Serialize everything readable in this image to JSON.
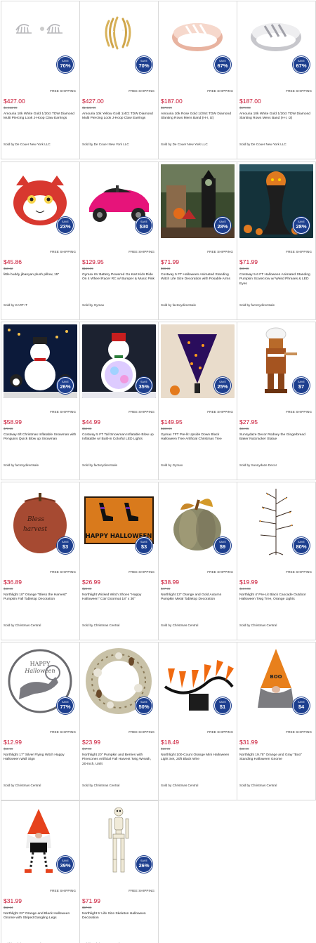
{
  "labels": {
    "free_shipping": "FREE SHIPPING",
    "save": "SAVE"
  },
  "products": [
    {
      "price": "$427.00",
      "was": "$1,423.99",
      "save": "70%",
      "title": "Amouria 10k White Gold 1/20ct TDW Diamond Multi Piercing Look J-Hoop Claw Earrings",
      "sold": "Sold by De Couer New York LLC",
      "img": "earrings-silver"
    },
    {
      "price": "$427.00",
      "was": "$1,423.99",
      "save": "70%",
      "title": "Amouria 10k Yellow Gold 1/4Ct TDW Diamond Multi Piercing Look J-Hoop Claw Earrings",
      "sold": "Sold by De Couer New York LLC",
      "img": "earrings-gold"
    },
    {
      "price": "$187.00",
      "was": "$578.99",
      "save": "67%",
      "title": "Amouria 10k Rose Gold 1/20ct TDW Diamond Slanting Rows Mens Band (H-I, I2)",
      "sold": "Sold by De Couer New York LLC",
      "img": "ring-rose"
    },
    {
      "price": "$187.00",
      "was": "$578.99",
      "save": "67%",
      "title": "Amouria 10k White Gold 1/20ct TDW Diamond Slanting Rows Mens Band (H-I, I2)",
      "sold": "Sold by De Couer New York LLC",
      "img": "ring-white"
    },
    {
      "price": "$45.86",
      "was": "$59.62",
      "save": "23%",
      "title": "little buddy jibanyan plush pillow, 15\"",
      "sold": "Sold by KART IT",
      "img": "plush"
    },
    {
      "price": "$129.95",
      "was": "$159.99",
      "save": "$30",
      "title": "Gymax 6V Battery Powered Go Kart Kids Ride On 4 Wheel Racer RC w/ Bumper & Music Pink",
      "sold": "Sold by Gymax",
      "img": "gokart"
    },
    {
      "price": "$71.99",
      "was": "$99.99",
      "save": "28%",
      "title": "Costway 5 FT Halloween Animated Standing Witch Life Size Decoration with Posable Arms",
      "sold": "Sold by factorydirectsale",
      "img": "witch"
    },
    {
      "price": "$71.99",
      "was": "$99.99",
      "save": "28%",
      "title": "Costway 5.6 FT Halloween Animated Standing Pumpkin Scarecrow w/ Weird Phrases & LED Eyes",
      "sold": "Sold by factorydirectsale",
      "img": "scarecrow"
    },
    {
      "price": "$58.99",
      "was": "$79.99",
      "save": "26%",
      "title": "Costway 6ft Christmas Inflatable Snowman with Penguins Quick Blow up Snowman",
      "sold": "Sold by factorydirectsale",
      "img": "snowman-penguin"
    },
    {
      "price": "$44.99",
      "was": "$69.99",
      "save": "35%",
      "title": "Costway 5 FT Tall Snowman Inflatable Blow up Inflatable w/ Built-in Colorful LED Lights",
      "sold": "Sold by factorydirectsale",
      "img": "snowman-led"
    },
    {
      "price": "$149.95",
      "was": "$199.99",
      "save": "25%",
      "title": "Gymax 7FT Pre-lit Upside Down Black Halloween Tree Artificial Christmas Tree",
      "sold": "Sold by Gymax",
      "img": "tree-purple"
    },
    {
      "price": "$27.95",
      "was": "$34.95",
      "save": "$7",
      "title": "Sunnydaze Decor Rodney the Gingerbread Baker Nutcracker Statue",
      "sold": "Sold by Sunnydaze Decor",
      "img": "nutcracker"
    },
    {
      "price": "$36.89",
      "was": "$40.49",
      "save": "$3",
      "title": "Northlight 10\" Orange \"Bless the Harvest\" Pumpkin Fall Tabletop Decoration",
      "sold": "Sold by Christmas Central",
      "img": "pumpkin-bless"
    },
    {
      "price": "$26.99",
      "was": "$29.99",
      "save": "$3",
      "title": "Northlight Wicked Witch Shoes \"Happy Halloween\" Coir Doormat 18\" x 30\"",
      "sold": "Sold by Christmas Central",
      "img": "doormat"
    },
    {
      "price": "$38.99",
      "was": "$47.99",
      "save": "$9",
      "title": "Northlight 13\" Orange and Gold Autumn Pumpkin Metal Tabletop Decoration",
      "sold": "Sold by Christmas Central",
      "img": "pumpkin-gold"
    },
    {
      "price": "$19.99",
      "was": "$104.99",
      "save": "80%",
      "title": "Northlight 4' Pre-Lit Black Cascade Outdoor Halloween Twig Tree, Orange Lights",
      "sold": "Sold by Christmas Central",
      "img": "twig-tree"
    },
    {
      "price": "$12.99",
      "was": "$55.99",
      "save": "77%",
      "title": "Northlight 17\" Silver Flying Witch Happy Halloween Wall Sign",
      "sold": "Sold by Christmas Central",
      "img": "wall-sign"
    },
    {
      "price": "$23.99",
      "was": "$47.99",
      "save": "50%",
      "title": "Northlight 20\" Pumpkin and Berries with Pinecones Artificial Fall Harvest Twig Wreath, 20-Inch, Unlit",
      "sold": "Sold by Christmas Central",
      "img": "wreath"
    },
    {
      "price": "$18.49",
      "was": "$19.99",
      "save": "$1",
      "title": "Northlight 100-Count Orange Mini Halloween Light Set, 20ft Black Wire",
      "sold": "Sold by Christmas Central",
      "img": "lights"
    },
    {
      "price": "$31.99",
      "was": "$35.49",
      "save": "$4",
      "title": "Northlight 19.75\" Orange and Gray \"Boo\" Standing Halloween Gnome",
      "sold": "Sold by Christmas Central",
      "img": "gnome-boo"
    },
    {
      "price": "$31.99",
      "was": "$52.14",
      "save": "39%",
      "title": "Northlight 22\" Orange and Black Halloween Gnome with Striped Dangling Legs",
      "sold": "Sold by Christmas Central",
      "img": "gnome-legs"
    },
    {
      "price": "$71.99",
      "was": "$97.99",
      "save": "26%",
      "title": "Northlight 5' Life Size Skeleton Halloween Decoration",
      "sold": "Sold by Christmas Central",
      "img": "skeleton"
    }
  ]
}
